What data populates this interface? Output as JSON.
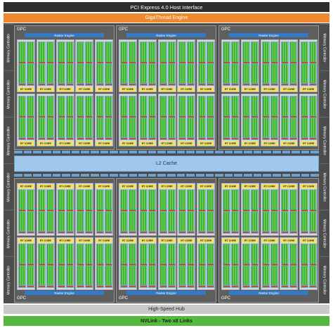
{
  "header": {
    "pcie": "PCI Express 4.0 Host Interface",
    "gigathread": "GigaThread Engine"
  },
  "footer": {
    "hub": "High-Speed Hub",
    "nvlink": "NVLink - Two x8 Links"
  },
  "l2cache": "L2 Cache",
  "memory_controller_label": "Memory Controller",
  "memory_controllers_per_side": 6,
  "gpcs": [
    {
      "label": "GPC",
      "raster": "Raster Engine",
      "row": 0,
      "col": 0
    },
    {
      "label": "GPC",
      "raster": "Raster Engine",
      "row": 0,
      "col": 1
    },
    {
      "label": "GPC",
      "raster": "Raster Engine",
      "row": 0,
      "col": 2
    },
    {
      "label": "GPC",
      "raster": "Raster Engine",
      "row": 1,
      "col": 0
    },
    {
      "label": "GPC",
      "raster": "Raster Engine",
      "row": 1,
      "col": 1
    },
    {
      "label": "GPC",
      "raster": "Raster Engine",
      "row": 1,
      "col": 2
    }
  ],
  "tpc": {
    "label": "TPC",
    "rt_core": "RT CORE",
    "per_gpc": 10
  },
  "colors": {
    "pcie": "#2d2d2d",
    "gigathread": "#f0892d",
    "nvlink": "#56b83f",
    "hub": "#c9c9c9",
    "raster": "#2f7bc8",
    "l2": "#9fc8ea",
    "rt_core": "#f4e35a",
    "cuda": "#3fb43a"
  }
}
